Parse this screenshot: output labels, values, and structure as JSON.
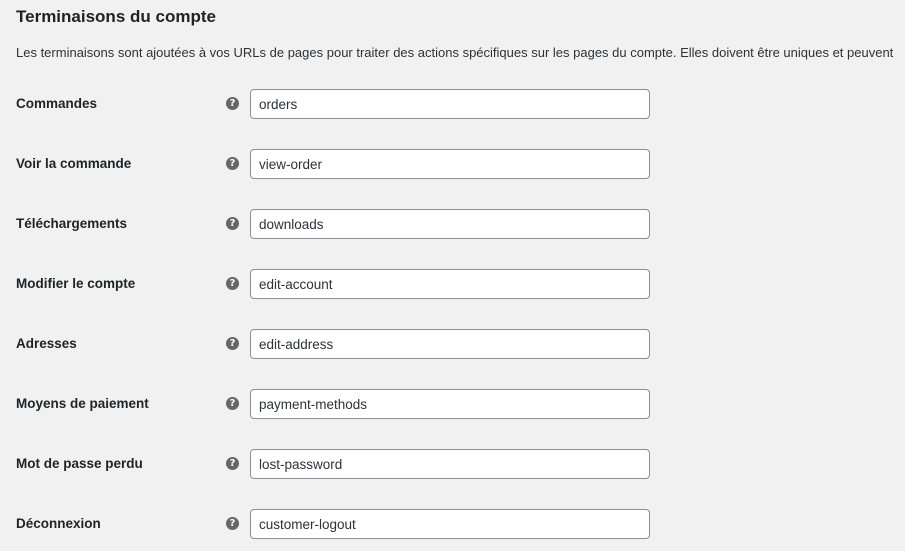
{
  "section": {
    "title": "Terminaisons du compte",
    "description": "Les terminaisons sont ajoutées à vos URLs de pages pour traiter des actions spécifiques sur les pages du compte. Elles doivent être uniques et peuvent"
  },
  "help_icon": {
    "glyph": "?",
    "icon_name": "help-tip-icon",
    "color": "#666666"
  },
  "endpoints": [
    {
      "label": "Commandes",
      "value": "orders"
    },
    {
      "label": "Voir la commande",
      "value": "view-order"
    },
    {
      "label": "Téléchargements",
      "value": "downloads"
    },
    {
      "label": "Modifier le compte",
      "value": "edit-account"
    },
    {
      "label": "Adresses",
      "value": "edit-address"
    },
    {
      "label": "Moyens de paiement",
      "value": "payment-methods"
    },
    {
      "label": "Mot de passe perdu",
      "value": "lost-password"
    },
    {
      "label": "Déconnexion",
      "value": "customer-logout"
    }
  ]
}
